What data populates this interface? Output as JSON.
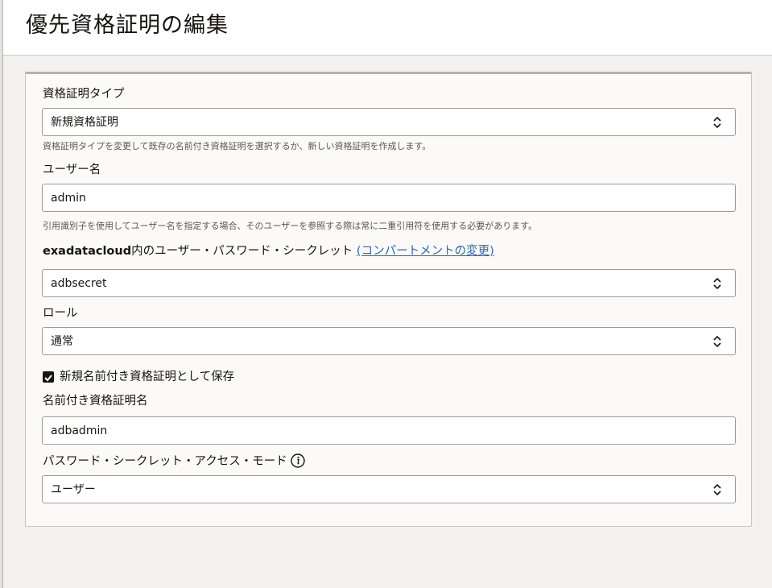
{
  "header": {
    "title": "優先資格証明の編集"
  },
  "form": {
    "credential_type": {
      "label": "資格証明タイプ",
      "value": "新規資格証明",
      "help": "資格証明タイプを変更して既存の名前付き資格証明を選択するか、新しい資格証明を作成します。"
    },
    "username": {
      "label": "ユーザー名",
      "value": "admin",
      "help": "引用識別子を使用してユーザー名を指定する場合、そのユーザーを参照する際は常に二重引用符を使用する必要があります。"
    },
    "secret": {
      "compartment": "exadatacloud",
      "label_suffix": "内のユーザー・パスワード・シークレット",
      "change_link": "(コンパートメントの変更)",
      "value": "adbsecret"
    },
    "role": {
      "label": "ロール",
      "value": "通常"
    },
    "save_named": {
      "label": "新規名前付き資格証明として保存",
      "checked": true
    },
    "named_credential": {
      "label": "名前付き資格証明名",
      "value": "adbadmin"
    },
    "access_mode": {
      "label": "パスワード・シークレット・アクセス・モード",
      "value": "ユーザー"
    }
  },
  "icons": {
    "select_arrow": "up-down-chevron-icon",
    "info": "info-icon",
    "checkmark": "checkmark-icon"
  }
}
